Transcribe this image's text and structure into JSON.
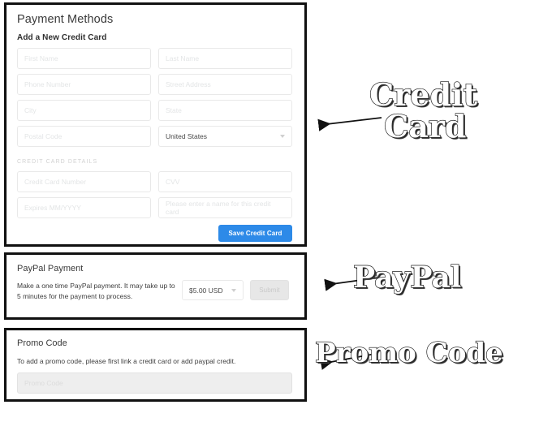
{
  "credit_card_panel": {
    "title": "Payment Methods",
    "subtitle": "Add a New Credit Card",
    "section_label": "CREDIT CARD DETAILS",
    "fields": {
      "first_name_placeholder": "First Name",
      "last_name_placeholder": "Last Name",
      "phone_placeholder": "Phone Number",
      "street_placeholder": "Street Address",
      "city_placeholder": "City",
      "state_placeholder": "State",
      "postal_placeholder": "Postal Code",
      "country_value": "United States",
      "card_number_placeholder": "Credit Card Number",
      "cvv_placeholder": "CVV",
      "expires_placeholder": "Expires MM/YYYY",
      "card_name_placeholder": "Please enter a name for this credit card"
    },
    "save_button": "Save Credit Card",
    "accent_color": "#2d8ae8"
  },
  "paypal_panel": {
    "title": "PayPal Payment",
    "description": "Make a one time PayPal payment. It may take up to 5 minutes for the payment to process.",
    "amount_value": "$5.00 USD",
    "submit_button": "Submit"
  },
  "promo_panel": {
    "title": "Promo Code",
    "description": "To add a promo code, please first link a credit card or add paypal credit.",
    "input_placeholder": "Promo Code"
  },
  "annotations": [
    {
      "line1": "Credit",
      "line2": "Card"
    },
    {
      "line1": "PayPal"
    },
    {
      "line1": "Promo Code"
    }
  ]
}
